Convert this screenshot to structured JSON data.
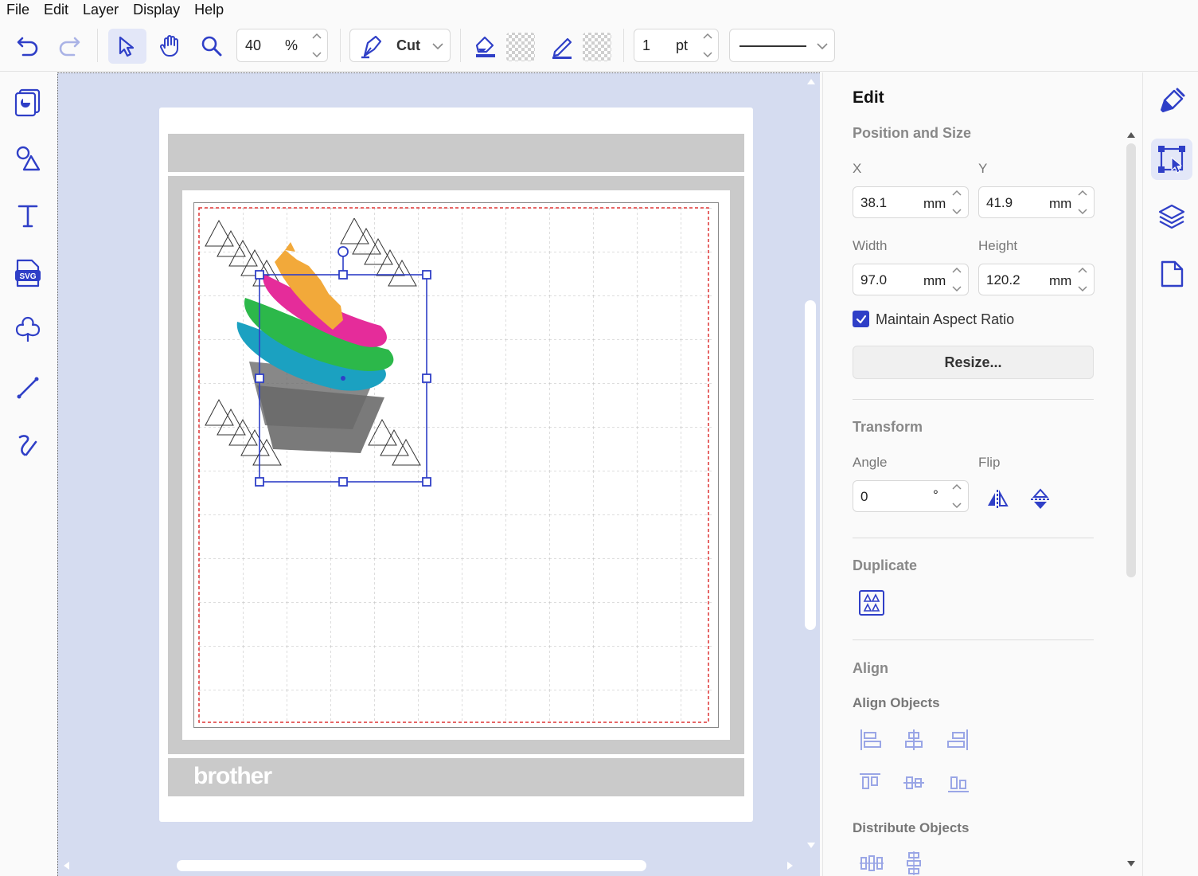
{
  "menu": [
    "File",
    "Edit",
    "Layer",
    "Display",
    "Help"
  ],
  "toolbar": {
    "zoom_value": "40",
    "zoom_unit": "%",
    "mode_label": "Cut",
    "line_width_value": "1",
    "line_width_unit": "pt"
  },
  "panel": {
    "title": "Edit",
    "position_size_title": "Position and Size",
    "x_label": "X",
    "x_value": "38.1",
    "x_unit": "mm",
    "y_label": "Y",
    "y_value": "41.9",
    "y_unit": "mm",
    "width_label": "Width",
    "width_value": "97.0",
    "width_unit": "mm",
    "height_label": "Height",
    "height_value": "120.2",
    "height_unit": "mm",
    "aspect_label": "Maintain Aspect Ratio",
    "aspect_checked": true,
    "resize_label": "Resize...",
    "transform_title": "Transform",
    "angle_label": "Angle",
    "angle_value": "0",
    "angle_unit": "°",
    "flip_label": "Flip",
    "duplicate_title": "Duplicate",
    "align_title": "Align",
    "align_objects_label": "Align Objects",
    "distribute_objects_label": "Distribute Objects"
  },
  "canvas": {
    "brand_text": "brother"
  },
  "colors": {
    "accent": "#2f3fc7",
    "canvas_bg": "#d5dcf0",
    "icon_blue": "#3a4bd0",
    "disabled_blue": "#9aa6e6"
  },
  "icons": {
    "left_rail": [
      "templates-icon",
      "shapes-icon",
      "text-icon",
      "svg-import-icon",
      "pattern-icon",
      "line-icon",
      "freehand-icon"
    ],
    "right_rail": [
      "paint-brush-icon",
      "edit-selection-icon",
      "layers-icon",
      "page-icon"
    ]
  }
}
